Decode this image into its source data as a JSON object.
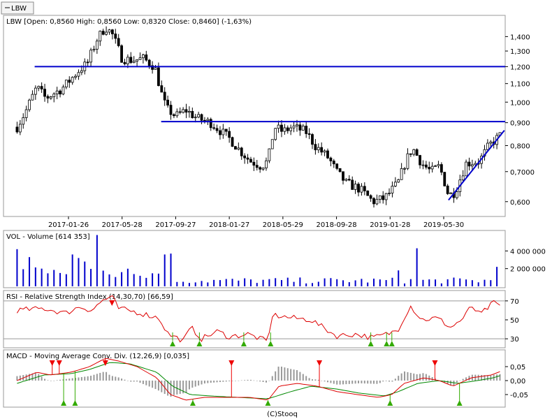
{
  "symbol_button": "LBW",
  "footer": "(C)Stooq",
  "colors": {
    "line": "#0000cc",
    "volume": "#0000cc",
    "up": "#ffffff",
    "down": "#000000",
    "rsi": "#dd0000",
    "macd": "#dd0000",
    "signal": "#008800",
    "hist": "#999999",
    "sell_marker": "#ee0000",
    "buy_marker": "#33aa00"
  },
  "chart_data": [
    {
      "type": "candlestick",
      "title": "LBW [Open: 0,8560  High: 0,8560  Low: 0,8320  Close: 0,8460] (-1,63%)",
      "x_labels": [
        "2017-01-26",
        "2017-05-28",
        "2017-09-27",
        "2018-01-27",
        "2018-05-29",
        "2018-09-28",
        "2019-01-28",
        "2019-05-30"
      ],
      "y_scale": "log",
      "ylim": [
        0.56,
        1.55
      ],
      "y_ticks": [
        "1,400",
        "1,300",
        "1,200",
        "1,100",
        "1,000",
        "0,900",
        "0,800",
        "0,7000",
        "0,600"
      ],
      "y_values": [
        1.4,
        1.3,
        1.2,
        1.1,
        1.0,
        0.9,
        0.8,
        0.7,
        0.6
      ],
      "horizontal_lines": [
        {
          "value": 1.2,
          "start_date": "2016-11-10"
        },
        {
          "value": 0.905,
          "start_date": "2017-08-25"
        }
      ],
      "trend_line": {
        "start": [
          "2019-06-10",
          0.605
        ],
        "end": [
          "2019-10-15",
          0.865
        ]
      },
      "series": [
        {
          "start_date": "2016-10-01",
          "end_date": "2019-10-10",
          "close_path": [
            [
              "2016-10-01",
              0.88
            ],
            [
              "2016-10-20",
              0.95
            ],
            [
              "2016-11-15",
              1.08
            ],
            [
              "2016-12-05",
              1.02
            ],
            [
              "2017-01-10",
              1.07
            ],
            [
              "2017-01-26",
              1.11
            ],
            [
              "2017-02-20",
              1.18
            ],
            [
              "2017-03-10",
              1.22
            ],
            [
              "2017-04-01",
              1.38
            ],
            [
              "2017-04-20",
              1.47
            ],
            [
              "2017-05-05",
              1.42
            ],
            [
              "2017-05-28",
              1.25
            ],
            [
              "2017-06-20",
              1.24
            ],
            [
              "2017-07-15",
              1.25
            ],
            [
              "2017-08-10",
              1.2
            ],
            [
              "2017-08-25",
              1.05
            ],
            [
              "2017-09-05",
              0.97
            ],
            [
              "2017-09-27",
              0.93
            ],
            [
              "2017-10-20",
              0.96
            ],
            [
              "2017-11-15",
              0.92
            ],
            [
              "2017-12-15",
              0.9
            ],
            [
              "2018-01-27",
              0.83
            ],
            [
              "2018-02-20",
              0.78
            ],
            [
              "2018-03-15",
              0.74
            ],
            [
              "2018-04-10",
              0.72
            ],
            [
              "2018-04-25",
              0.74
            ],
            [
              "2018-05-10",
              0.88
            ],
            [
              "2018-05-29",
              0.86
            ],
            [
              "2018-06-20",
              0.88
            ],
            [
              "2018-07-20",
              0.86
            ],
            [
              "2018-08-10",
              0.8
            ],
            [
              "2018-09-10",
              0.75
            ],
            [
              "2018-09-28",
              0.7
            ],
            [
              "2018-10-20",
              0.66
            ],
            [
              "2018-11-20",
              0.64
            ],
            [
              "2018-12-20",
              0.6
            ],
            [
              "2019-01-15",
              0.61
            ],
            [
              "2019-01-28",
              0.63
            ],
            [
              "2019-02-15",
              0.66
            ],
            [
              "2019-03-05",
              0.74
            ],
            [
              "2019-03-20",
              0.79
            ],
            [
              "2019-04-10",
              0.73
            ],
            [
              "2019-05-01",
              0.7
            ],
            [
              "2019-05-20",
              0.72
            ],
            [
              "2019-06-10",
              0.62
            ],
            [
              "2019-06-25",
              0.63
            ],
            [
              "2019-07-20",
              0.73
            ],
            [
              "2019-08-20",
              0.74
            ],
            [
              "2019-09-10",
              0.8
            ],
            [
              "2019-10-10",
              0.85
            ]
          ]
        }
      ]
    },
    {
      "type": "bar",
      "title": "VOL - Volume [614 353]",
      "y_ticks": [
        "4 000 000",
        "2 000 000"
      ],
      "y_values": [
        4000000,
        2000000
      ],
      "ylim": [
        0,
        6000000
      ],
      "spikes": [
        [
          "2016-10-05",
          4200000
        ],
        [
          "2016-10-25",
          3300000
        ],
        [
          "2016-11-20",
          2000000
        ],
        [
          "2017-02-01",
          3600000
        ],
        [
          "2017-02-20",
          3200000
        ],
        [
          "2017-03-05",
          2800000
        ],
        [
          "2017-04-01",
          5800000
        ],
        [
          "2017-09-01",
          3600000
        ],
        [
          "2017-09-10",
          3700000
        ],
        [
          "2019-02-15",
          1800000
        ],
        [
          "2019-03-25",
          4300000
        ],
        [
          "2019-09-25",
          2200000
        ]
      ]
    },
    {
      "type": "line",
      "title": "RSI - Relative Strength Index (14,30,70) [66,59]",
      "y_ticks": [
        "70",
        "50",
        "30"
      ],
      "y_values": [
        70,
        50,
        30
      ],
      "ylim": [
        22,
        78
      ],
      "reference_lines": [
        70,
        30
      ],
      "path": [
        [
          "2016-10-01",
          60
        ],
        [
          "2016-12-01",
          62
        ],
        [
          "2017-01-20",
          57
        ],
        [
          "2017-02-20",
          64
        ],
        [
          "2017-03-20",
          60
        ],
        [
          "2017-04-15",
          71
        ],
        [
          "2017-05-05",
          74
        ],
        [
          "2017-05-20",
          62
        ],
        [
          "2017-07-01",
          58
        ],
        [
          "2017-08-20",
          52
        ],
        [
          "2017-09-10",
          35
        ],
        [
          "2017-10-15",
          28
        ],
        [
          "2017-11-01",
          42
        ],
        [
          "2017-11-25",
          30
        ],
        [
          "2018-01-01",
          38
        ],
        [
          "2018-01-27",
          32
        ],
        [
          "2018-03-10",
          35
        ],
        [
          "2018-04-25",
          27
        ],
        [
          "2018-05-05",
          55
        ],
        [
          "2018-06-20",
          52
        ],
        [
          "2018-08-01",
          50
        ],
        [
          "2018-09-28",
          33
        ],
        [
          "2018-11-10",
          35
        ],
        [
          "2018-12-20",
          31
        ],
        [
          "2019-01-28",
          36
        ],
        [
          "2019-02-15",
          40
        ],
        [
          "2019-03-15",
          65
        ],
        [
          "2019-04-10",
          50
        ],
        [
          "2019-05-15",
          52
        ],
        [
          "2019-06-15",
          42
        ],
        [
          "2019-07-15",
          52
        ],
        [
          "2019-08-01",
          65
        ],
        [
          "2019-08-20",
          55
        ],
        [
          "2019-09-20",
          68
        ],
        [
          "2019-10-10",
          64
        ]
      ],
      "markers": [
        {
          "date": "2017-05-05",
          "type": "sell"
        },
        {
          "date": "2017-09-20",
          "type": "buy"
        },
        {
          "date": "2017-11-20",
          "type": "buy"
        },
        {
          "date": "2018-03-01",
          "type": "buy"
        },
        {
          "date": "2018-05-01",
          "type": "buy"
        },
        {
          "date": "2018-12-15",
          "type": "buy"
        },
        {
          "date": "2019-01-20",
          "type": "buy"
        },
        {
          "date": "2019-02-01",
          "type": "buy"
        }
      ]
    },
    {
      "type": "line",
      "title": "MACD - Moving Average Conv. Div. (12,26,9) [0,035]",
      "y_ticks": [
        "0,05",
        "0,00",
        "-0,05"
      ],
      "y_values": [
        0.05,
        0.0,
        -0.05
      ],
      "ylim": [
        -0.09,
        0.1
      ],
      "macd": [
        [
          "2016-10-01",
          0.0
        ],
        [
          "2016-11-15",
          0.03
        ],
        [
          "2016-12-15",
          0.02
        ],
        [
          "2017-02-01",
          0.03
        ],
        [
          "2017-03-15",
          0.05
        ],
        [
          "2017-04-20",
          0.08
        ],
        [
          "2017-05-20",
          0.07
        ],
        [
          "2017-07-01",
          0.05
        ],
        [
          "2017-08-15",
          0.01
        ],
        [
          "2017-09-15",
          -0.05
        ],
        [
          "2017-10-20",
          -0.07
        ],
        [
          "2017-12-01",
          -0.06
        ],
        [
          "2018-01-27",
          -0.06
        ],
        [
          "2018-03-15",
          -0.06
        ],
        [
          "2018-04-25",
          -0.07
        ],
        [
          "2018-05-20",
          -0.02
        ],
        [
          "2018-07-01",
          -0.01
        ],
        [
          "2018-08-15",
          -0.02
        ],
        [
          "2018-10-01",
          -0.04
        ],
        [
          "2018-11-15",
          -0.05
        ],
        [
          "2019-01-01",
          -0.06
        ],
        [
          "2019-02-01",
          -0.05
        ],
        [
          "2019-03-01",
          -0.01
        ],
        [
          "2019-04-15",
          0.01
        ],
        [
          "2019-05-20",
          0.0
        ],
        [
          "2019-06-20",
          -0.02
        ],
        [
          "2019-08-01",
          0.01
        ],
        [
          "2019-09-15",
          0.02
        ],
        [
          "2019-10-10",
          0.035
        ]
      ],
      "signal": [
        [
          "2016-10-01",
          -0.01
        ],
        [
          "2016-12-01",
          0.02
        ],
        [
          "2017-02-01",
          0.025
        ],
        [
          "2017-03-15",
          0.04
        ],
        [
          "2017-05-01",
          0.065
        ],
        [
          "2017-06-15",
          0.06
        ],
        [
          "2017-08-15",
          0.03
        ],
        [
          "2017-09-20",
          -0.02
        ],
        [
          "2017-10-30",
          -0.05
        ],
        [
          "2017-12-15",
          -0.055
        ],
        [
          "2018-02-15",
          -0.06
        ],
        [
          "2018-04-25",
          -0.065
        ],
        [
          "2018-06-15",
          -0.04
        ],
        [
          "2018-08-01",
          -0.02
        ],
        [
          "2018-09-28",
          -0.03
        ],
        [
          "2018-11-20",
          -0.045
        ],
        [
          "2019-01-15",
          -0.055
        ],
        [
          "2019-02-15",
          -0.04
        ],
        [
          "2019-04-01",
          -0.01
        ],
        [
          "2019-05-20",
          0.0
        ],
        [
          "2019-07-01",
          -0.01
        ],
        [
          "2019-08-15",
          0.0
        ],
        [
          "2019-09-20",
          0.01
        ],
        [
          "2019-10-10",
          0.02
        ]
      ],
      "markers": [
        {
          "date": "2016-12-20",
          "type": "sell"
        },
        {
          "date": "2017-01-05",
          "type": "sell"
        },
        {
          "date": "2017-01-15",
          "type": "buy"
        },
        {
          "date": "2017-02-10",
          "type": "buy"
        },
        {
          "date": "2017-04-20",
          "type": "sell"
        },
        {
          "date": "2017-11-05",
          "type": "buy"
        },
        {
          "date": "2018-02-01",
          "type": "sell"
        },
        {
          "date": "2018-04-25",
          "type": "buy"
        },
        {
          "date": "2018-08-20",
          "type": "sell"
        },
        {
          "date": "2019-01-28",
          "type": "buy"
        },
        {
          "date": "2019-05-10",
          "type": "sell"
        },
        {
          "date": "2019-07-05",
          "type": "buy"
        }
      ]
    }
  ]
}
